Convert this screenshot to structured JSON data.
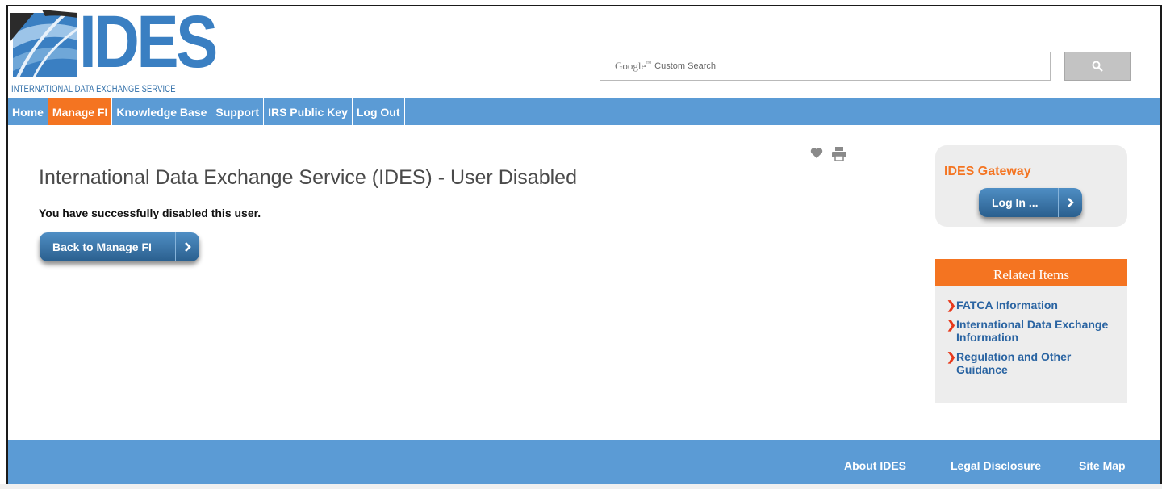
{
  "header": {
    "logo_title": "IDES",
    "logo_subtitle": "INTERNATIONAL DATA EXCHANGE SERVICE",
    "search": {
      "brand": "Google",
      "brand_mark": "™",
      "placeholder": "Custom Search"
    }
  },
  "nav": {
    "items": [
      {
        "label": "Home",
        "active": false
      },
      {
        "label": "Manage FI",
        "active": true
      },
      {
        "label": "Knowledge Base",
        "active": false
      },
      {
        "label": "Support",
        "active": false
      },
      {
        "label": "IRS Public Key",
        "active": false
      },
      {
        "label": "Log Out",
        "active": false
      }
    ]
  },
  "main": {
    "title": "International Data Exchange Service (IDES) - User Disabled",
    "message": "You have successfully disabled this user.",
    "back_button_label": "Back to Manage FI",
    "tool_icons": [
      "heart-icon",
      "print-icon"
    ]
  },
  "sidebar": {
    "gateway_title": "IDES Gateway",
    "login_button_label": "Log In ...",
    "related_title": "Related Items",
    "related_items": [
      "FATCA Information",
      "International Data Exchange Information",
      "Regulation and Other Guidance"
    ]
  },
  "footer": {
    "links": [
      "About IDES",
      "Legal Disclosure",
      "Site Map"
    ]
  },
  "colors": {
    "brand_blue": "#5b9bd5",
    "accent_orange": "#f47421",
    "button_blue": "#2a5f8e",
    "link_blue": "#2a64a2"
  }
}
